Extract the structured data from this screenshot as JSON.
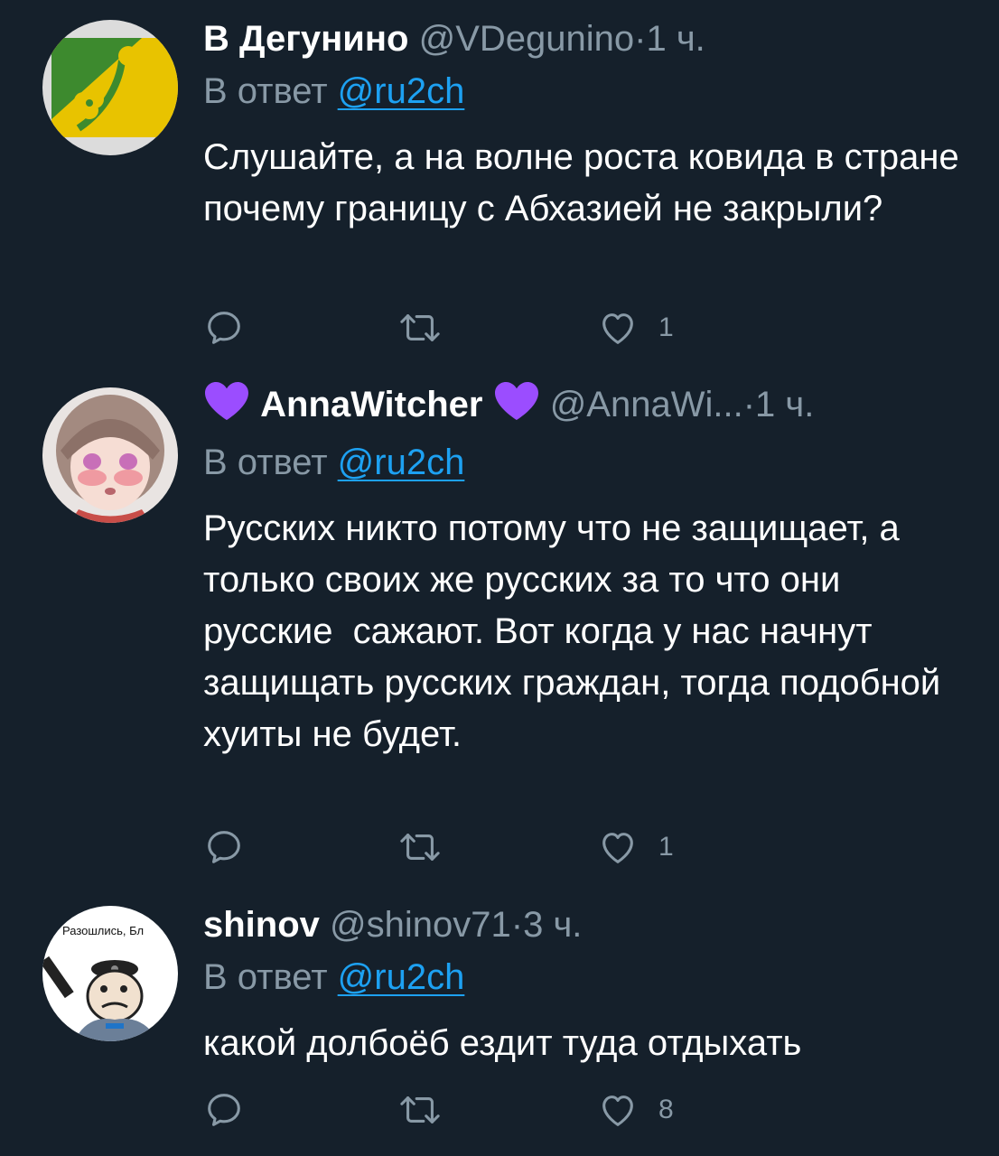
{
  "tweets": [
    {
      "display_name": "В Дегунино",
      "handle": "@VDegunino",
      "separator": "·",
      "time": "1 ч.",
      "reply_prefix": "В ответ",
      "reply_mention": "@ru2ch",
      "text": "Слушайте, а на волне роста ковида в стране почему границу с Абхазией не закрыли?",
      "actions": {
        "reply_icon": "reply-icon",
        "retweet_icon": "retweet-icon",
        "like_icon": "heart-outline-icon",
        "like_count": "1"
      }
    },
    {
      "display_name": "AnnaWitcher",
      "name_emoji": "purple-heart",
      "handle": "@AnnaWi...",
      "separator": "·",
      "time": "1 ч.",
      "reply_prefix": "В ответ",
      "reply_mention": "@ru2ch",
      "text": "Русских никто потому что не защищает, а только своих же русских за то что они русские  сажают. Вот когда у нас начнут защищать русских граждан, тогда подобной хуиты не будет.",
      "actions": {
        "reply_icon": "reply-icon",
        "retweet_icon": "retweet-icon",
        "like_icon": "heart-outline-icon",
        "like_count": "1"
      }
    },
    {
      "display_name": "shinov",
      "handle": "@shinov71",
      "separator": "·",
      "time": "3 ч.",
      "reply_prefix": "В ответ",
      "reply_mention": "@ru2ch",
      "text": "какой долбоёб ездит туда отдыхать",
      "avatar_caption": "Разошлись, Бл",
      "actions": {
        "reply_icon": "reply-icon",
        "retweet_icon": "retweet-icon",
        "like_icon": "heart-outline-icon",
        "like_count": "8"
      }
    }
  ],
  "colors": {
    "background": "#15202b",
    "primary_text": "#ffffff",
    "secondary_text": "#8899a6",
    "link": "#1da1f2",
    "emoji_purple": "#9b4dff"
  }
}
